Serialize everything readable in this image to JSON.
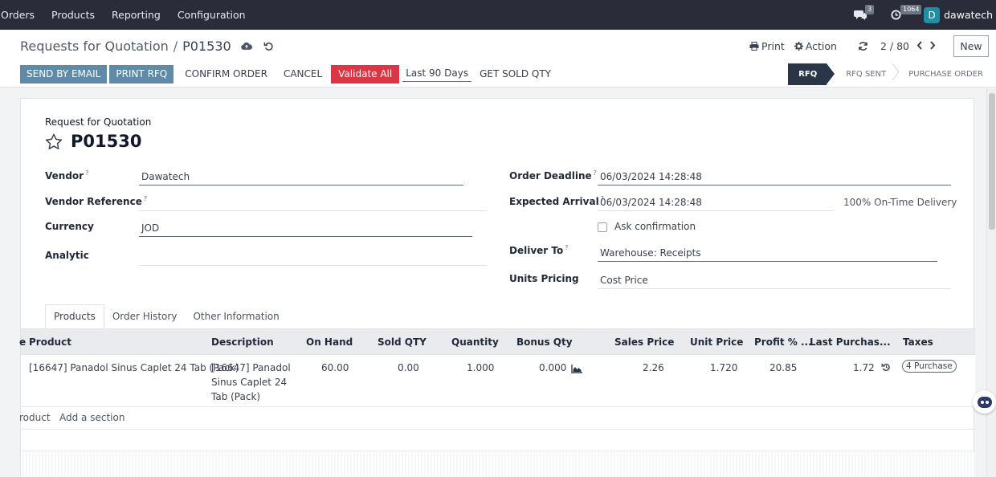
{
  "nav": {
    "menu": [
      "Orders",
      "Products",
      "Reporting",
      "Configuration"
    ],
    "messages_count": "3",
    "activities_count": "1064",
    "user_initial": "D",
    "user_name": "dawatech"
  },
  "control": {
    "breadcrumb_parent": "Requests for Quotation",
    "breadcrumb_sep": "/",
    "breadcrumb_current": "P01530",
    "print_label": "Print",
    "action_label": "Action",
    "pager": "2 / 80",
    "new_label": "New"
  },
  "actions": {
    "send_email": "SEND BY EMAIL",
    "print_rfq": "PRINT RFQ",
    "confirm_order": "CONFIRM ORDER",
    "cancel": "CANCEL",
    "validate_all": "Validate All",
    "date_range": "Last 90 Days",
    "get_sold_qty": "GET SOLD QTY"
  },
  "statusbar": [
    "RFQ",
    "RFQ SENT",
    "PURCHASE ORDER"
  ],
  "form": {
    "subtitle": "Request for Quotation",
    "name": "P01530",
    "vendor_label": "Vendor",
    "vendor": "Dawatech",
    "vendor_ref_label": "Vendor Reference",
    "vendor_ref": "",
    "currency_label": "Currency",
    "currency": "JOD",
    "analytic_label": "Analytic",
    "analytic": "",
    "order_deadline_label": "Order Deadline",
    "order_deadline": "06/03/2024 14:28:48",
    "expected_arrival_label": "Expected Arrival",
    "expected_arrival": "06/03/2024 14:28:48",
    "on_time": "100% On-Time Delivery",
    "ask_confirmation": "Ask confirmation",
    "deliver_to_label": "Deliver To",
    "deliver_to": "Warehouse: Receipts",
    "units_pricing_label": "Units Pricing",
    "units_pricing": "Cost Price",
    "help": "?"
  },
  "tabs": [
    "Products",
    "Order History",
    "Other Information"
  ],
  "table": {
    "headers": [
      "e",
      "Product",
      "Description",
      "On Hand",
      "Sold QTY",
      "Quantity",
      "Bonus Qty",
      "Sales Price",
      "Unit Price",
      "Profit % ...",
      "Last Purchas...",
      "Taxes"
    ],
    "row": {
      "product": "[16647] Panadol Sinus Caplet 24 Tab (Pack)",
      "desc1": "[16647] Panadol",
      "desc2": "Sinus Caplet 24",
      "desc3": "Tab (Pack)",
      "on_hand": "60.00",
      "sold_qty": "0.00",
      "quantity": "1.000",
      "bonus_qty": "0.000",
      "sales_price": "2.26",
      "unit_price": "1.720",
      "profit": "20.85",
      "last_purchase": "1.72",
      "tax": "4 Purchase"
    },
    "add_product": "roduct",
    "add_section": "Add a section"
  }
}
